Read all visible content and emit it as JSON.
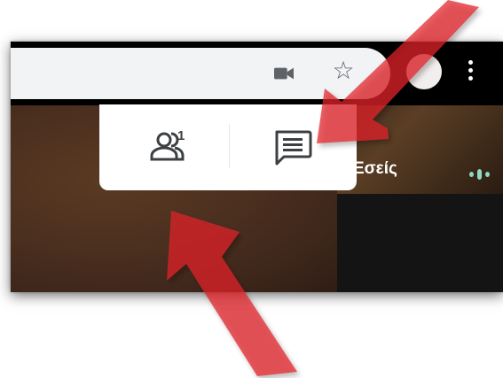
{
  "meeting": {
    "participant_tile_label": "Εσείς",
    "people_count": "1"
  },
  "toolbar": {
    "icons": [
      "video-camera-icon",
      "bookmark-star-icon",
      "profile-avatar",
      "more-options-icon"
    ]
  },
  "panel": {
    "buttons": [
      "people-button",
      "chat-button"
    ]
  },
  "colors": {
    "annotation_arrow": "#e0232a",
    "panel_background": "#ffffff",
    "omnibox_background": "#f1f3f4",
    "audio_indicator": "#8fd9c6"
  }
}
